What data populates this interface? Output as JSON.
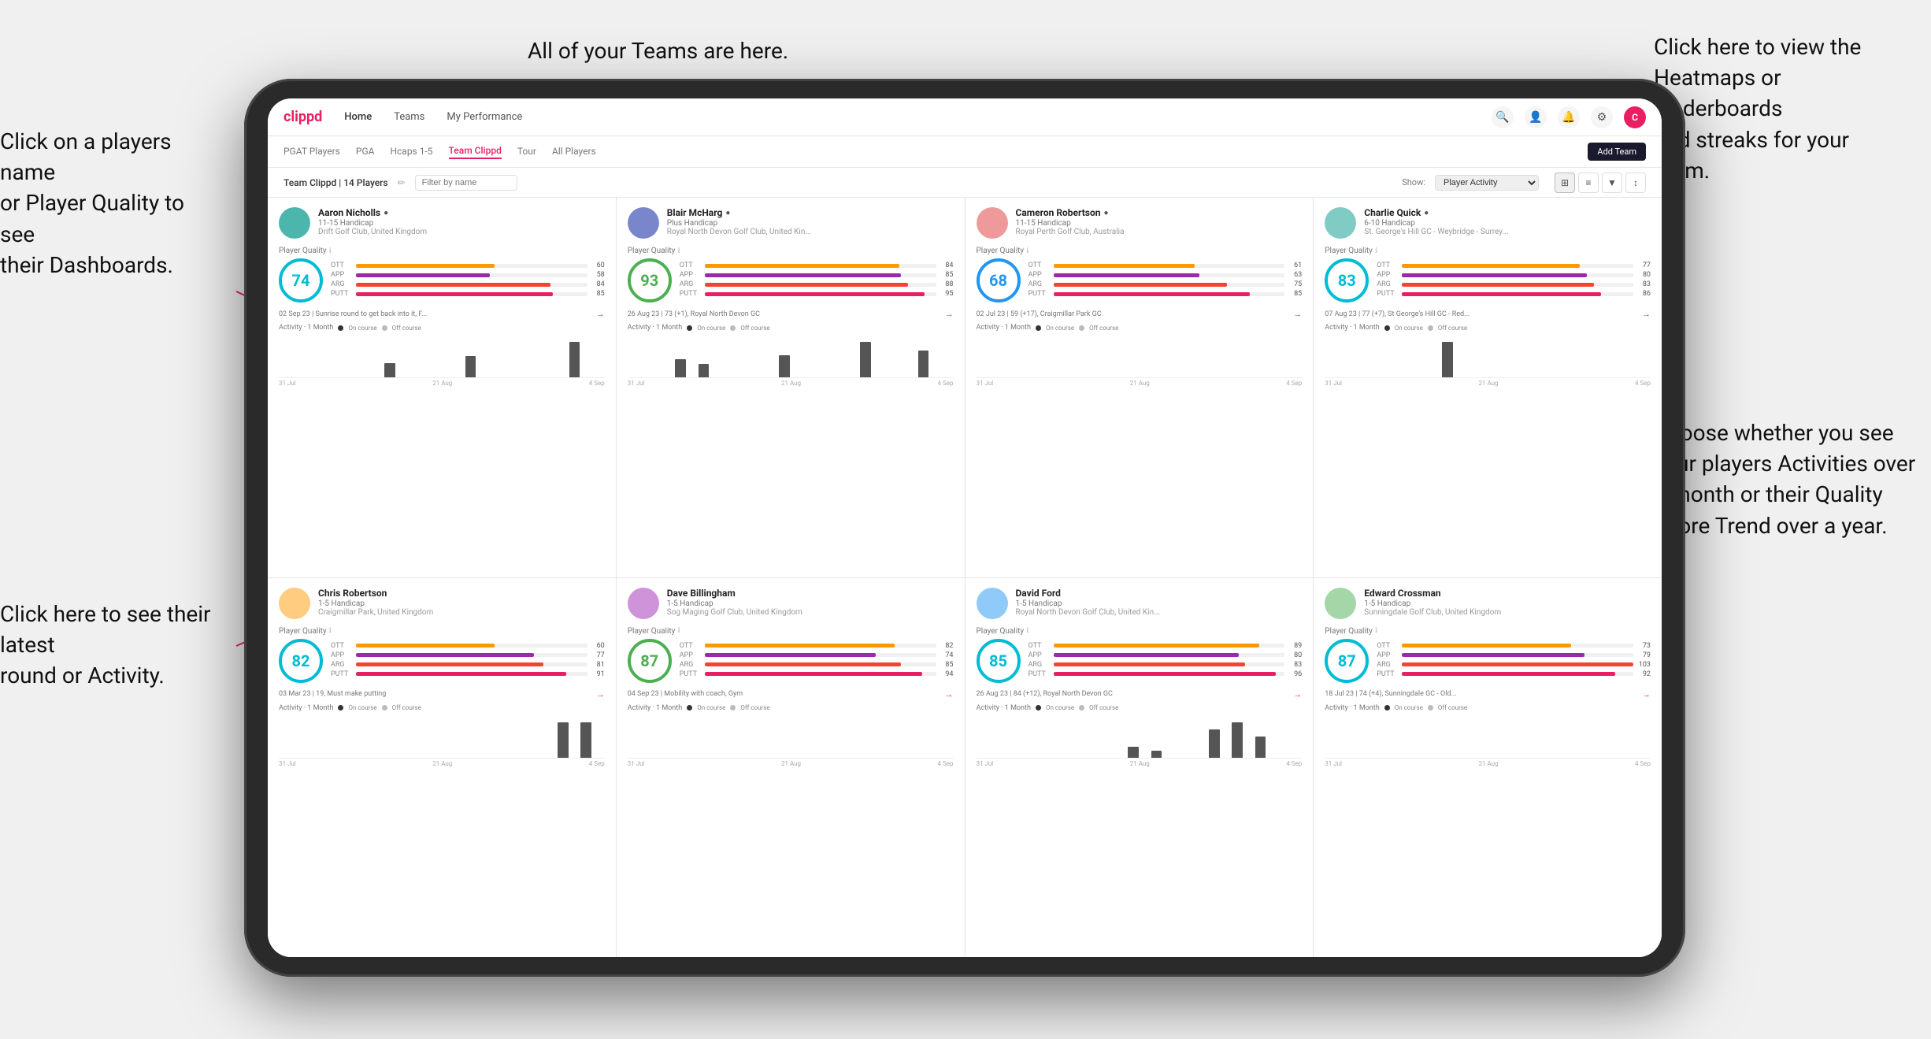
{
  "annotations": {
    "teams_tooltip": "All of your Teams are here.",
    "heatmaps_tooltip": "Click here to view the\nHeatmaps or leaderboards\nand streaks for your team.",
    "player_name_tooltip": "Click on a players name\nor Player Quality to see\ntheir Dashboards.",
    "round_tooltip": "Click here to see their latest\nround or Activity.",
    "activity_tooltip": "Choose whether you see\nyour players Activities over\na month or their Quality\nScore Trend over a year."
  },
  "nav": {
    "logo": "clippd",
    "items": [
      "Home",
      "Teams",
      "My Performance"
    ],
    "add_team": "Add Team"
  },
  "sub_nav": {
    "items": [
      "PGAT Players",
      "PGA",
      "Hcaps 1-5",
      "Team Clippd",
      "Tour",
      "All Players"
    ]
  },
  "toolbar": {
    "team_label": "Team Clippd | 14 Players",
    "filter_placeholder": "Filter by name",
    "show_label": "Show:",
    "show_option": "Player Activity"
  },
  "players": [
    {
      "name": "Aaron Nicholls",
      "handicap": "11-15 Handicap",
      "club": "Drift Golf Club, United Kingdom",
      "quality": 74,
      "quality_color": "cyan",
      "ott": 60,
      "app": 58,
      "arg": 84,
      "putt": 85,
      "recent": "02 Sep 23 | Sunrise round to get back into it, F...",
      "bars": [
        0,
        0,
        0,
        0,
        0,
        0,
        0,
        0,
        0,
        2,
        0,
        0,
        0,
        0,
        0,
        0,
        3,
        0,
        0,
        0,
        0,
        0,
        0,
        0,
        0,
        5,
        0,
        0
      ],
      "dates": [
        "31 Jul",
        "21 Aug",
        "4 Sep"
      ]
    },
    {
      "name": "Blair McHarg",
      "handicap": "Plus Handicap",
      "club": "Royal North Devon Golf Club, United Kin...",
      "quality": 93,
      "quality_color": "green",
      "ott": 84,
      "app": 85,
      "arg": 88,
      "putt": 95,
      "recent": "26 Aug 23 | 73 (+1), Royal North Devon GC",
      "bars": [
        0,
        0,
        0,
        0,
        4,
        0,
        3,
        0,
        0,
        0,
        0,
        0,
        0,
        5,
        0,
        0,
        0,
        0,
        0,
        0,
        8,
        0,
        0,
        0,
        0,
        6,
        0,
        0
      ],
      "dates": [
        "31 Jul",
        "21 Aug",
        "4 Sep"
      ]
    },
    {
      "name": "Cameron Robertson",
      "handicap": "11-15 Handicap",
      "club": "Royal Perth Golf Club, Australia",
      "quality": 68,
      "quality_color": "blue",
      "ott": 61,
      "app": 63,
      "arg": 75,
      "putt": 85,
      "recent": "02 Jul 23 | 59 (+17), Craigmillar Park GC",
      "bars": [
        0,
        0,
        0,
        0,
        0,
        0,
        0,
        0,
        0,
        0,
        0,
        0,
        0,
        0,
        0,
        0,
        0,
        0,
        0,
        0,
        0,
        0,
        0,
        0,
        0,
        0,
        0,
        0
      ],
      "dates": [
        "31 Jul",
        "21 Aug",
        "4 Sep"
      ]
    },
    {
      "name": "Charlie Quick",
      "handicap": "6-10 Handicap",
      "club": "St. George's Hill GC - Weybridge - Surrey...",
      "quality": 83,
      "quality_color": "cyan",
      "ott": 77,
      "app": 80,
      "arg": 83,
      "putt": 86,
      "recent": "07 Aug 23 | 77 (+7), St George's Hill GC - Red...",
      "bars": [
        0,
        0,
        0,
        0,
        0,
        0,
        0,
        0,
        0,
        0,
        3,
        0,
        0,
        0,
        0,
        0,
        0,
        0,
        0,
        0,
        0,
        0,
        0,
        0,
        0,
        0,
        0,
        0
      ],
      "dates": [
        "31 Jul",
        "21 Aug",
        "4 Sep"
      ]
    },
    {
      "name": "Chris Robertson",
      "handicap": "1-5 Handicap",
      "club": "Craigmillar Park, United Kingdom",
      "quality": 82,
      "quality_color": "cyan",
      "ott": 60,
      "app": 77,
      "arg": 81,
      "putt": 91,
      "recent": "03 Mar 23 | 19, Must make putting",
      "bars": [
        0,
        0,
        0,
        0,
        0,
        0,
        0,
        0,
        0,
        0,
        0,
        0,
        0,
        0,
        0,
        0,
        0,
        0,
        0,
        0,
        0,
        0,
        0,
        0,
        4,
        0,
        4,
        0
      ],
      "dates": [
        "31 Jul",
        "21 Aug",
        "4 Sep"
      ]
    },
    {
      "name": "Dave Billingham",
      "handicap": "1-5 Handicap",
      "club": "Sog Maging Golf Club, United Kingdom",
      "quality": 87,
      "quality_color": "green",
      "ott": 82,
      "app": 74,
      "arg": 85,
      "putt": 94,
      "recent": "04 Sep 23 | Mobility with coach, Gym",
      "bars": [
        0,
        0,
        0,
        0,
        0,
        0,
        0,
        0,
        0,
        0,
        0,
        0,
        0,
        0,
        0,
        0,
        0,
        0,
        0,
        0,
        0,
        0,
        0,
        0,
        0,
        0,
        0,
        0
      ],
      "dates": [
        "31 Jul",
        "21 Aug",
        "4 Sep"
      ]
    },
    {
      "name": "David Ford",
      "handicap": "1-5 Handicap",
      "club": "Royal North Devon Golf Club, United Kin...",
      "quality": 85,
      "quality_color": "cyan",
      "ott": 89,
      "app": 80,
      "arg": 83,
      "putt": 96,
      "recent": "26 Aug 23 | 84 (+12), Royal North Devon GC",
      "bars": [
        0,
        0,
        0,
        0,
        0,
        0,
        0,
        0,
        0,
        0,
        0,
        0,
        0,
        3,
        0,
        2,
        0,
        0,
        0,
        0,
        8,
        0,
        10,
        0,
        6,
        0,
        0,
        0
      ],
      "dates": [
        "31 Jul",
        "21 Aug",
        "4 Sep"
      ]
    },
    {
      "name": "Edward Crossman",
      "handicap": "1-5 Handicap",
      "club": "Sunningdale Golf Club, United Kingdom",
      "quality": 87,
      "quality_color": "cyan",
      "ott": 73,
      "app": 79,
      "arg": 103,
      "putt": 92,
      "recent": "18 Jul 23 | 74 (+4), Sunningdale GC - Old...",
      "bars": [
        0,
        0,
        0,
        0,
        0,
        0,
        0,
        0,
        0,
        0,
        0,
        0,
        0,
        0,
        0,
        0,
        0,
        0,
        0,
        0,
        0,
        0,
        0,
        0,
        0,
        0,
        0,
        0
      ],
      "dates": [
        "31 Jul",
        "21 Aug",
        "4 Sep"
      ]
    }
  ]
}
